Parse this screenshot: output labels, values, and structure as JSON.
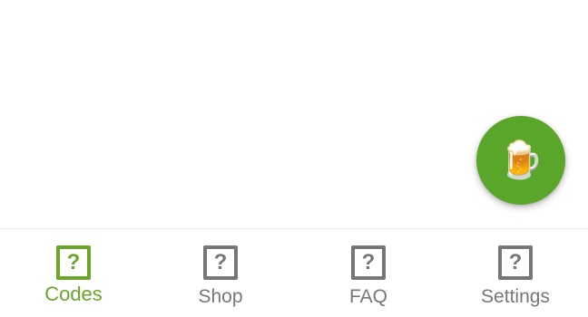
{
  "colors": {
    "accent": "#6aa52a",
    "inactive": "#777777",
    "fab_background": "#5aa62a"
  },
  "fab": {
    "icon": "beer-mug-icon",
    "glyph": "🍺"
  },
  "tabs": [
    {
      "label": "Codes",
      "icon": "unknown-image-icon",
      "glyph": "?",
      "active": true
    },
    {
      "label": "Shop",
      "icon": "unknown-image-icon",
      "glyph": "?",
      "active": false
    },
    {
      "label": "FAQ",
      "icon": "unknown-image-icon",
      "glyph": "?",
      "active": false
    },
    {
      "label": "Settings",
      "icon": "unknown-image-icon",
      "glyph": "?",
      "active": false
    }
  ]
}
